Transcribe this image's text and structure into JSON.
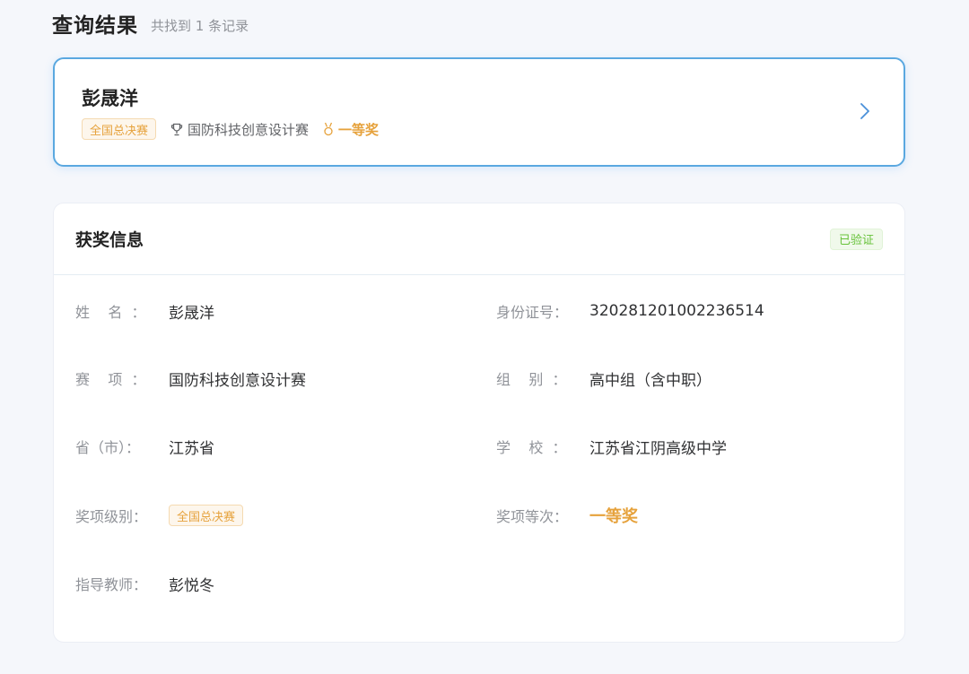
{
  "header": {
    "title": "查询结果",
    "count_text": "共找到 1 条记录"
  },
  "result_card": {
    "name": "彭晟洋",
    "level_tag": "全国总决赛",
    "competition": "国防科技创意设计赛",
    "award": "一等奖",
    "icons": {
      "competition": "trophy-icon",
      "award": "medal-icon",
      "open": "chevron-right-icon"
    }
  },
  "info": {
    "title": "获奖信息",
    "badge": "已验证",
    "fields": {
      "name": {
        "label": "姓    名  ：",
        "value": "彭晟洋"
      },
      "id_number": {
        "label": "身份证号：",
        "value": "320281201002236514"
      },
      "event": {
        "label": "赛    项  ：",
        "value": "国防科技创意设计赛"
      },
      "group": {
        "label": "组    别  ：",
        "value": "高中组（含中职）"
      },
      "province": {
        "label": "省（市）：",
        "value": "江苏省"
      },
      "school": {
        "label": "学    校  ：",
        "value": "江苏省江阴高级中学"
      },
      "award_level": {
        "label": "奖项级别：",
        "value": "全国总决赛"
      },
      "award_rank": {
        "label": "奖项等次：",
        "value": "一等奖"
      },
      "teacher": {
        "label": "指导教师：",
        "value": "彭悦冬"
      }
    }
  },
  "colors": {
    "accent_blue": "#5aa8e0",
    "gold": "#e6a23c",
    "success_green": "#67c23a"
  }
}
